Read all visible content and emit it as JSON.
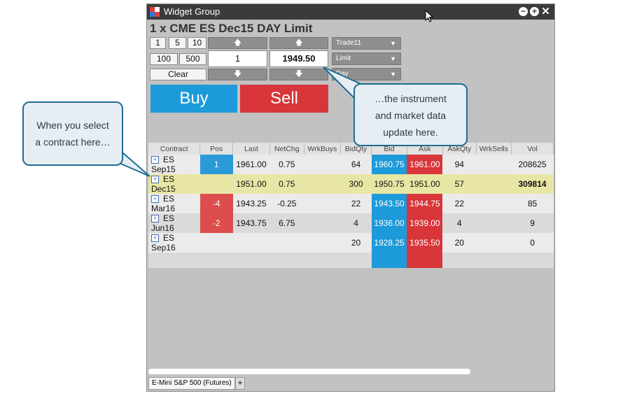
{
  "window": {
    "title": "Widget Group"
  },
  "order": {
    "title": "1 x CME ES Dec15 DAY Limit",
    "qty_buttons": [
      "1",
      "5",
      "10",
      "100",
      "500"
    ],
    "clear_label": "Clear",
    "quantity": "1",
    "price": "1949.50",
    "account": "Trade11",
    "order_type": "Limit",
    "tif": "Day",
    "buy_label": "Buy",
    "sell_label": "Sell"
  },
  "grid": {
    "columns": [
      "Contract",
      "Pos",
      "Last",
      "NetChg",
      "WrkBuys",
      "BidQty",
      "Bid",
      "Ask",
      "AskQty",
      "WrkSells",
      "Vol"
    ],
    "rows": [
      {
        "contract": "ES Sep15",
        "pos": "1",
        "last": "1961.00",
        "netchg": "0.75",
        "wrkbuys": "",
        "bidqty": "64",
        "bid": "1960.75",
        "ask": "1961.00",
        "askqty": "94",
        "wrksells": "",
        "vol": "208625"
      },
      {
        "contract": "ES Dec15",
        "pos": "",
        "last": "1951.00",
        "netchg": "0.75",
        "wrkbuys": "",
        "bidqty": "300",
        "bid": "1950.75",
        "ask": "1951.00",
        "askqty": "57",
        "wrksells": "",
        "vol": "309814"
      },
      {
        "contract": "ES Mar16",
        "pos": "-4",
        "last": "1943.25",
        "netchg": "-0.25",
        "wrkbuys": "",
        "bidqty": "22",
        "bid": "1943.50",
        "ask": "1944.75",
        "askqty": "22",
        "wrksells": "",
        "vol": "85"
      },
      {
        "contract": "ES Jun16",
        "pos": "-2",
        "last": "1943.75",
        "netchg": "6.75",
        "wrkbuys": "",
        "bidqty": "4",
        "bid": "1936.00",
        "ask": "1939.00",
        "askqty": "4",
        "wrksells": "",
        "vol": "9"
      },
      {
        "contract": "ES Sep16",
        "pos": "",
        "last": "",
        "netchg": "",
        "wrkbuys": "",
        "bidqty": "20",
        "bid": "1928.25",
        "ask": "1935.50",
        "askqty": "20",
        "wrksells": "",
        "vol": "0"
      }
    ]
  },
  "tabs": {
    "active": "E-Mini S&P 500 (Futures)",
    "add": "+"
  },
  "callouts": {
    "left": [
      "When you select",
      "a contract here…"
    ],
    "right": [
      "…the instrument",
      "and market data",
      "update here."
    ]
  },
  "colors": {
    "buy": "#1d9ad9",
    "sell": "#d8363a",
    "titlebar": "#3b3b3b",
    "selected_row": "#e8e6a4"
  }
}
